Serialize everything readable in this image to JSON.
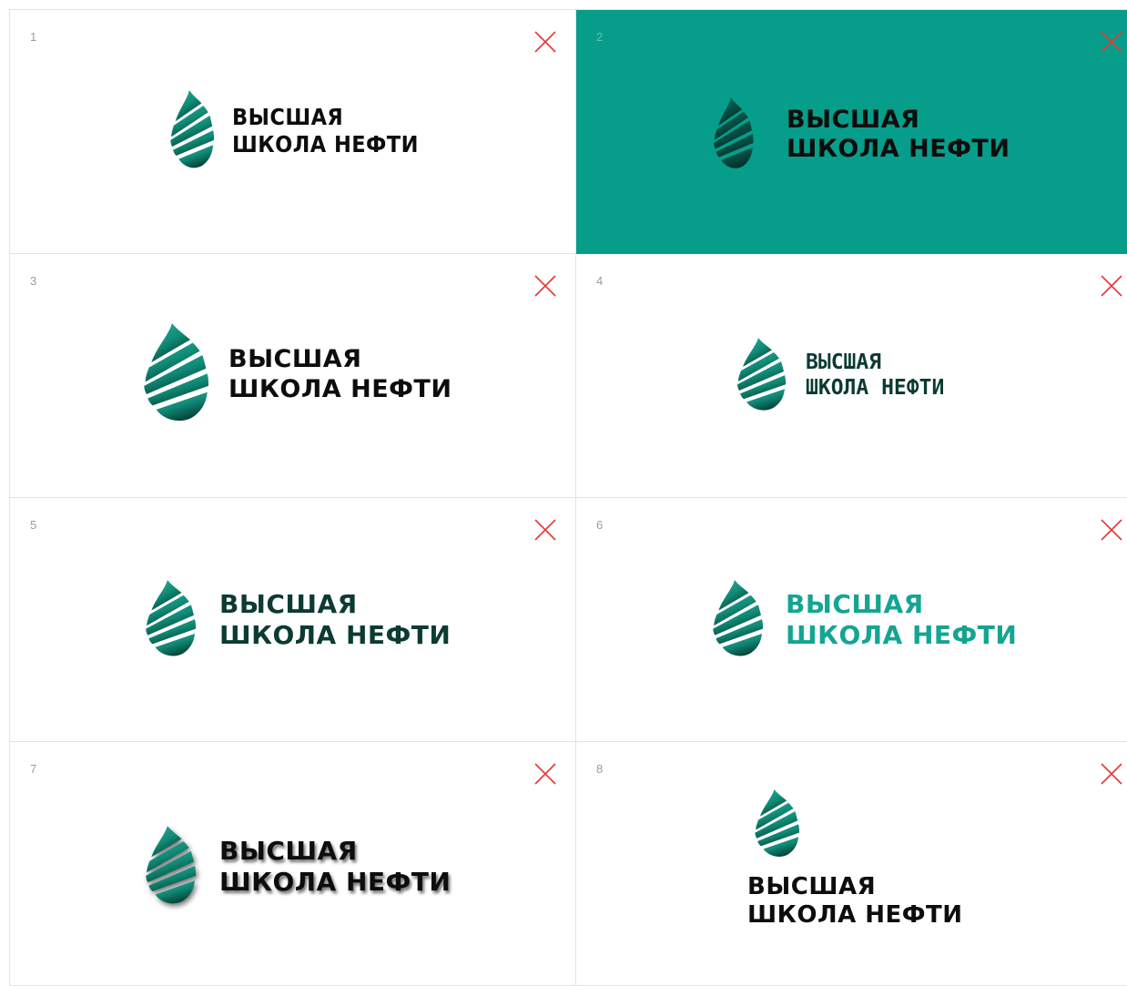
{
  "brand": {
    "line1": "ВЫСШАЯ",
    "line2": "ШКОЛА НЕФТИ",
    "colors": {
      "drop_light": "#2fb39c",
      "drop_mid": "#0f8a76",
      "drop_dark": "#053f35",
      "panel_teal": "#079d8b",
      "wordmark_black": "#0d0d0d",
      "wordmark_dark_green": "#0b3b32",
      "wordmark_teal": "#14a592",
      "wrong_mark": "#e53935"
    }
  },
  "icons": {
    "logo": "oil-drop-icon",
    "wrong_mark": "red-cross-icon"
  },
  "examples": [
    {
      "number": "1",
      "note": "logo distorted",
      "wrong": true
    },
    {
      "number": "2",
      "note": "logo on teal background",
      "wrong": true
    },
    {
      "number": "3",
      "note": "logo drop enlarged",
      "wrong": true
    },
    {
      "number": "4",
      "note": "wrong font",
      "wrong": true
    },
    {
      "number": "5",
      "note": "dark green wordmark",
      "wrong": true
    },
    {
      "number": "6",
      "note": "teal wordmark",
      "wrong": true
    },
    {
      "number": "7",
      "note": "drop shadow",
      "wrong": true
    },
    {
      "number": "8",
      "note": "vertical layout",
      "wrong": true
    }
  ]
}
